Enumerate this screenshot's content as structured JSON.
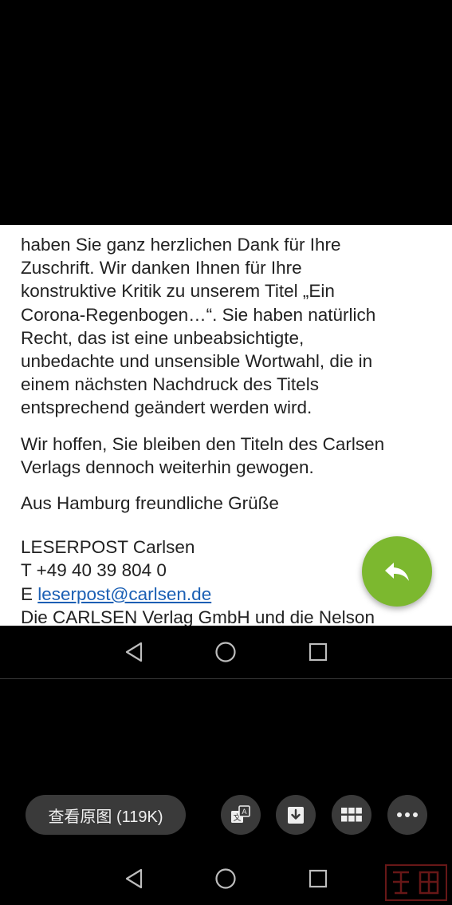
{
  "email": {
    "paragraph1": [
      "haben Sie ganz herzlichen Dank für Ihre",
      "Zuschrift. Wir danken Ihnen für Ihre",
      "konstruktive Kritik zu unserem Titel „Ein",
      "Corona-Regenbogen…“. Sie haben natürlich",
      "Recht, das ist eine unbeabsichtigte,",
      "unbedachte und unsensible Wortwahl, die in",
      "einem nächsten Nachdruck des Titels",
      "entsprechend geändert werden wird."
    ],
    "paragraph2": [
      "Wir hoffen, Sie bleiben den Titeln des Carlsen",
      "Verlags dennoch weiterhin gewogen."
    ],
    "greeting": "Aus Hamburg freundliche Grüße",
    "signature": {
      "name": "LESERPOST Carlsen",
      "phone": "T +49 40 39 804 0",
      "email_prefix": "E ",
      "email": "leserpost@carlsen.de",
      "cutoff_line": "Die CARLSEN Verlag GmbH und die Nelson"
    }
  },
  "fab": {
    "icon": "reply-icon",
    "color": "#7cb82f"
  },
  "nav": {
    "icons": [
      "back-triangle-icon",
      "home-circle-icon",
      "recents-square-icon"
    ]
  },
  "viewer": {
    "view_original_label": "查看原图 (119K)",
    "buttons": [
      "translate-icon",
      "download-icon",
      "grid-icon",
      "more-icon"
    ]
  },
  "colors": {
    "link": "#1a5fb4",
    "fab": "#7cb82f",
    "toolbar_button": "#3a3a3a"
  }
}
